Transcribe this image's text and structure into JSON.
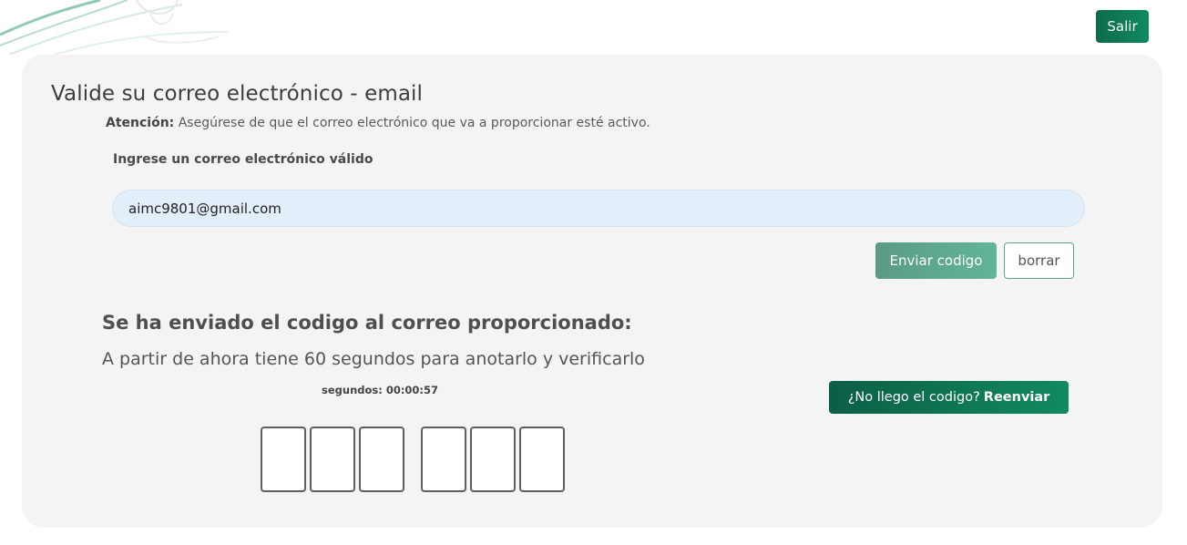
{
  "header": {
    "exit_label": "Salir"
  },
  "form": {
    "title": "Valide su correo electrónico - email",
    "attention_label": "Atención:",
    "attention_text": " Asegúrese de que el correo electrónico que va a proporcionar esté activo.",
    "email_label": "Ingrese un correo electrónico válido",
    "email_value": "aimc9801@gmail.com",
    "send_label": "Enviar codigo",
    "clear_label": "borrar"
  },
  "verification": {
    "heading": "Se ha enviado el codigo al correo proporcionado:",
    "subtext": "A partir de ahora tiene 60 segundos para anotarlo y verificarlo",
    "timer": "segundos: 00:00:57",
    "resend_prefix": "¿No llego el codigo?",
    "resend_action": "Reenviar",
    "code_digits": [
      "",
      "",
      "",
      "",
      "",
      ""
    ]
  },
  "colors": {
    "primary": "#118a5e",
    "primary_dark": "#0c5e46",
    "card_bg": "#f4f4f4",
    "input_bg": "#e3eefb"
  }
}
